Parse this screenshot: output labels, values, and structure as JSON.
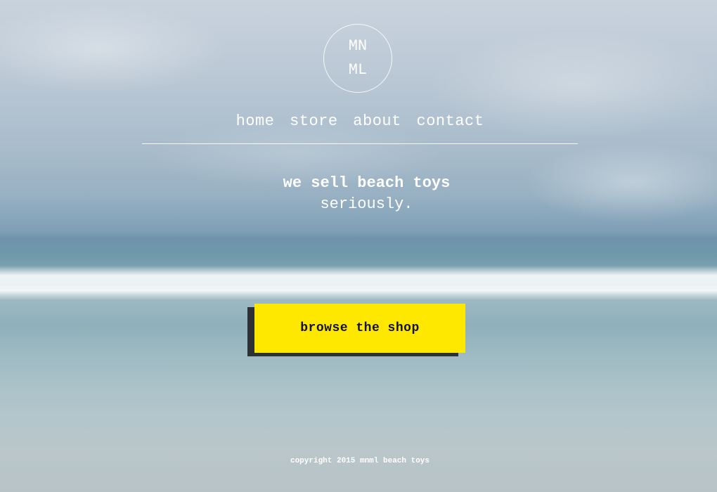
{
  "logo": {
    "line1": "MN",
    "line2": "ML"
  },
  "nav": {
    "items": [
      {
        "label": "home"
      },
      {
        "label": "store"
      },
      {
        "label": "about"
      },
      {
        "label": "contact"
      }
    ]
  },
  "hero": {
    "headline": "we sell beach toys",
    "subline": "seriously."
  },
  "cta": {
    "label": "browse the shop",
    "color": "#ffe800",
    "shadow_color": "#2e3133"
  },
  "footer": {
    "text": "copyright 2015 mnml beach toys"
  }
}
